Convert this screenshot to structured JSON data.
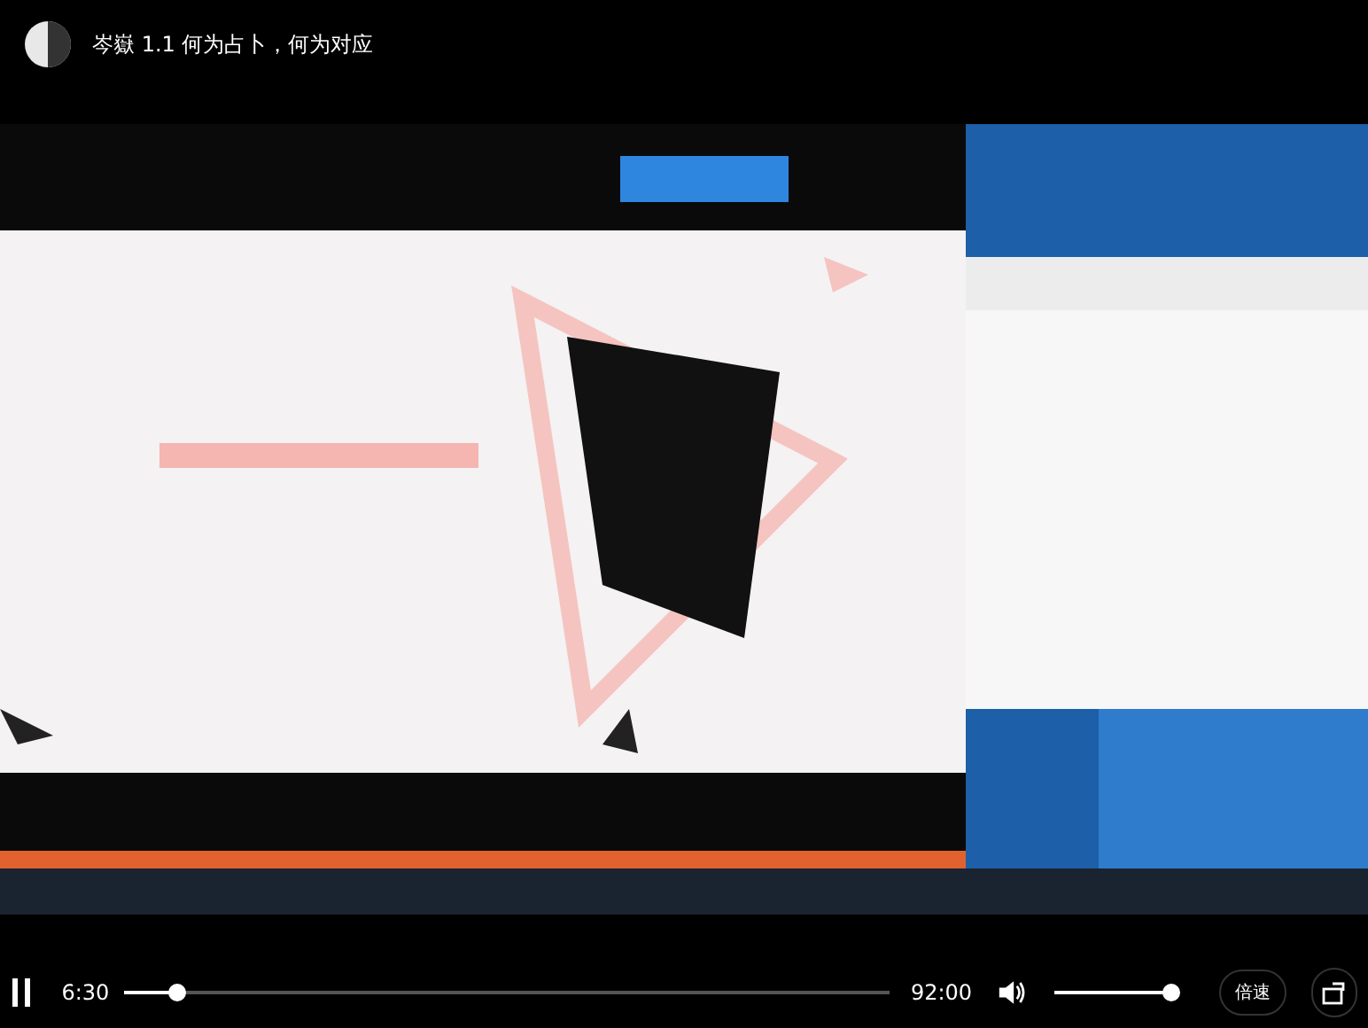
{
  "header": {
    "title": "岑嶽 1.1 何为占卜，何为对应"
  },
  "controls": {
    "playing": true,
    "current_time": "6:30",
    "progress": {
      "level": 0.07
    },
    "duration": "92:00",
    "volume": {
      "level": 0.98
    },
    "speed_button": "倍速"
  }
}
